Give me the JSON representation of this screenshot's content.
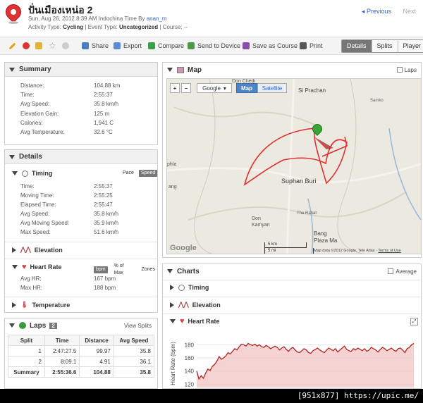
{
  "header": {
    "title": "ปั่นเมืองเหน่อ 2",
    "date_line_prefix": "Sun, Aug 26, 2012 8:39 AM Indochina Time By",
    "user": "anan_m",
    "activity_type_label": "Activity Type:",
    "activity_type": "Cycling",
    "event_type_label": "| Event Type:",
    "event_type": "Uncategorized",
    "course_label": "| Course:",
    "course": "--",
    "prev": "Previous",
    "next": "Next"
  },
  "toolbar": {
    "share": "Share",
    "export": "Export",
    "compare": "Compare",
    "send": "Send to Device",
    "save_course": "Save as Course",
    "print": "Print",
    "views": [
      "Details",
      "Splits",
      "Player"
    ]
  },
  "summary": {
    "title": "Summary",
    "rows": [
      {
        "label": "Distance:",
        "value": "104.88 km"
      },
      {
        "label": "Time:",
        "value": "2:55:37"
      },
      {
        "label": "Avg Speed:",
        "value": "35.8 km/h"
      },
      {
        "label": "Elevation Gain:",
        "value": "125 m"
      },
      {
        "label": "Calories:",
        "value": "1,941 C"
      },
      {
        "label": "Avg Temperature:",
        "value": "32.6 °C"
      }
    ]
  },
  "details": {
    "title": "Details",
    "timing": {
      "title": "Timing",
      "pace": "Pace",
      "speed": "Speed",
      "rows": [
        {
          "label": "Time:",
          "value": "2:55:37"
        },
        {
          "label": "Moving Time:",
          "value": "2:55:25"
        },
        {
          "label": "Elapsed Time:",
          "value": "2:55:47"
        },
        {
          "label": "Avg Speed:",
          "value": "35.8 km/h"
        },
        {
          "label": "Avg Moving Speed:",
          "value": "35.9 km/h"
        },
        {
          "label": "Max Speed:",
          "value": "51.6 km/h"
        }
      ]
    },
    "elevation": "Elevation",
    "heart_rate": {
      "title": "Heart Rate",
      "bpm": "bpm",
      "pct_max": "% of Max",
      "zones": "Zones",
      "rows": [
        {
          "label": "Avg HR:",
          "value": "167 bpm"
        },
        {
          "label": "Max HR:",
          "value": "188 bpm"
        }
      ]
    },
    "temperature": "Temperature"
  },
  "laps": {
    "title": "Laps",
    "count": "2",
    "view_splits": "View Splits",
    "headers": [
      "Split",
      "Time",
      "Distance",
      "Avg Speed"
    ],
    "rows": [
      [
        "1",
        "2:47:27.5",
        "99.97",
        "35.8"
      ],
      [
        "2",
        "8:09.1",
        "4.91",
        "36.1"
      ],
      [
        "Summary",
        "2:55:36.6",
        "104.88",
        "35.8"
      ]
    ]
  },
  "map": {
    "title": "Map",
    "laps_checkbox": "Laps",
    "plus": "+",
    "minus": "−",
    "provider": "Google",
    "map_btn": "Map",
    "satellite_btn": "Satellite",
    "places": {
      "don_chedi": "Don Chedi",
      "si_prachan": "Si Prachan",
      "samko": "Samko",
      "phla": "phla",
      "suphan_buri": "Suphan Buri",
      "tha_rahat": "Tha Rahat",
      "don_kamyan": "Don\nKamyan",
      "bang_plaza_ma": "Bang\nPlaza Ma",
      "ang": "ang"
    },
    "scale_km": "5 km",
    "scale_mi": "5 mi",
    "copyright": "Map data ©2012 Google, Tele Atlas -",
    "terms": "Terms of Use",
    "logo": "Google"
  },
  "charts": {
    "title": "Charts",
    "average_checkbox": "Average",
    "items": [
      "Timing",
      "Elevation",
      "Heart Rate"
    ]
  },
  "chart_data": {
    "type": "area",
    "ylabel": "Heart Rate (bpm)",
    "yticks": [
      180,
      160,
      140,
      120
    ],
    "ylim": [
      115,
      190
    ],
    "color": "#b22222",
    "values": [
      140,
      128,
      133,
      129,
      137,
      143,
      141,
      147,
      150,
      155,
      162,
      158,
      160,
      163,
      168,
      166,
      170,
      174,
      172,
      177,
      181,
      180,
      178,
      182,
      180,
      179,
      181,
      178,
      180,
      177,
      176,
      179,
      177,
      174,
      176,
      178,
      176,
      172,
      175,
      177,
      173,
      170,
      174,
      176,
      172,
      169,
      168,
      171,
      174,
      172,
      168,
      167,
      171,
      173,
      175,
      172,
      170,
      168,
      172,
      175,
      173,
      171,
      174,
      169,
      172,
      175,
      178,
      173,
      171,
      170,
      174,
      172,
      175,
      173,
      171,
      174,
      170,
      172,
      176,
      174,
      172,
      169,
      173,
      176,
      174,
      171,
      173,
      175,
      172,
      170,
      174,
      175,
      172,
      168,
      174,
      176,
      180,
      182
    ]
  },
  "footer": {
    "watermark": "[951x877] https://upic.me/"
  }
}
